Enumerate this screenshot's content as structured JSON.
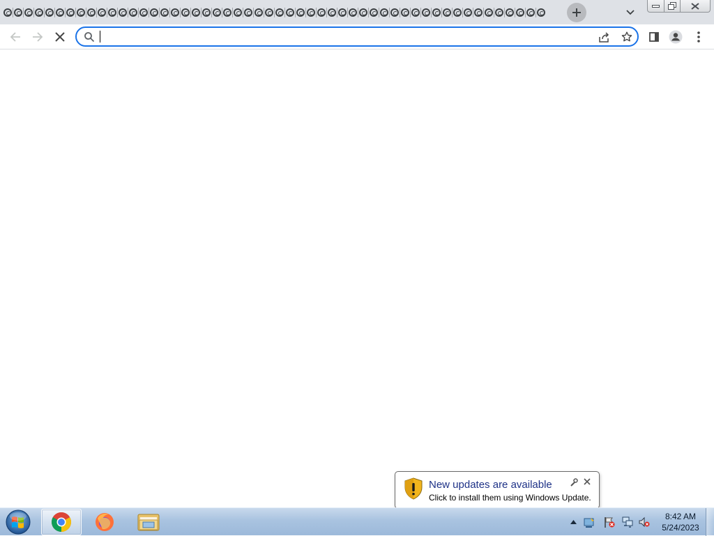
{
  "browser": {
    "tab_count": 52,
    "tab_icon": "loading-spinner-icon",
    "omnibox": {
      "value": "",
      "placeholder": ""
    }
  },
  "toolbar": {
    "back_icon": "arrow-left-icon",
    "forward_icon": "arrow-right-icon",
    "stop_icon": "close-icon",
    "share_icon": "share-icon",
    "bookmark_icon": "star-icon",
    "side_panel_icon": "side-panel-icon",
    "profile_icon": "person-icon",
    "menu_icon": "three-dots-icon"
  },
  "notification": {
    "title": "New updates are available",
    "text": "Click to install them using Windows Update.",
    "icon": "shield-warning-icon"
  },
  "taskbar": {
    "apps": [
      "chrome",
      "firefox",
      "file-explorer"
    ],
    "clock": {
      "time": "8:42 AM",
      "date": "5/24/2023"
    }
  },
  "colors": {
    "accent": "#1a73e8",
    "tabstrip_bg": "#dee1e6",
    "notification_title": "#1e3287"
  }
}
